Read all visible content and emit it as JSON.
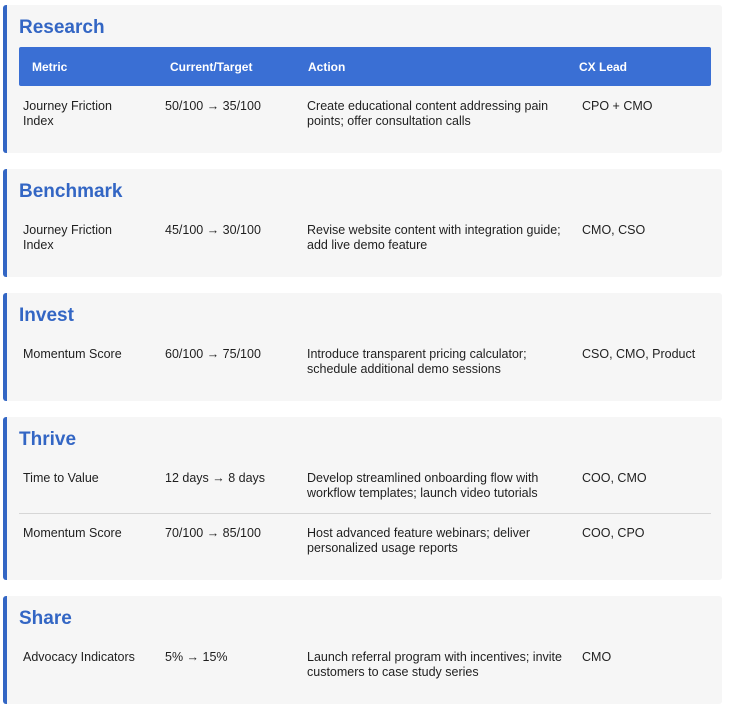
{
  "table_header": {
    "metric": "Metric",
    "current_target": "Current/Target",
    "action": "Action",
    "cx_lead": "CX Lead"
  },
  "sections": [
    {
      "title": "Research",
      "rows": [
        {
          "metric": "Journey Friction Index",
          "current_target": "50/100 → 35/100",
          "action": "Create educational content addressing pain points; offer consultation calls",
          "cx_lead": "CPO + CMO"
        }
      ]
    },
    {
      "title": "Benchmark",
      "rows": [
        {
          "metric": "Journey Friction Index",
          "current_target": "45/100 → 30/100",
          "action": "Revise website content with integration guide; add live demo feature",
          "cx_lead": "CMO, CSO"
        }
      ]
    },
    {
      "title": "Invest",
      "rows": [
        {
          "metric": "Momentum Score",
          "current_target": "60/100 → 75/100",
          "action": "Introduce transparent pricing calculator; schedule additional demo sessions",
          "cx_lead": "CSO, CMO, Product"
        }
      ]
    },
    {
      "title": "Thrive",
      "rows": [
        {
          "metric": "Time to Value",
          "current_target": "12 days → 8 days",
          "action": "Develop streamlined onboarding flow with workflow templates; launch video tutorials",
          "cx_lead": "COO, CMO"
        },
        {
          "metric": "Momentum Score",
          "current_target": "70/100 → 85/100",
          "action": "Host advanced feature webinars; deliver personalized usage reports",
          "cx_lead": "COO, CPO"
        }
      ]
    },
    {
      "title": "Share",
      "rows": [
        {
          "metric": "Advocacy Indicators",
          "current_target": "5% → 15%",
          "action": "Launch referral program with incentives; invite customers to case study series",
          "cx_lead": "CMO"
        }
      ]
    }
  ]
}
